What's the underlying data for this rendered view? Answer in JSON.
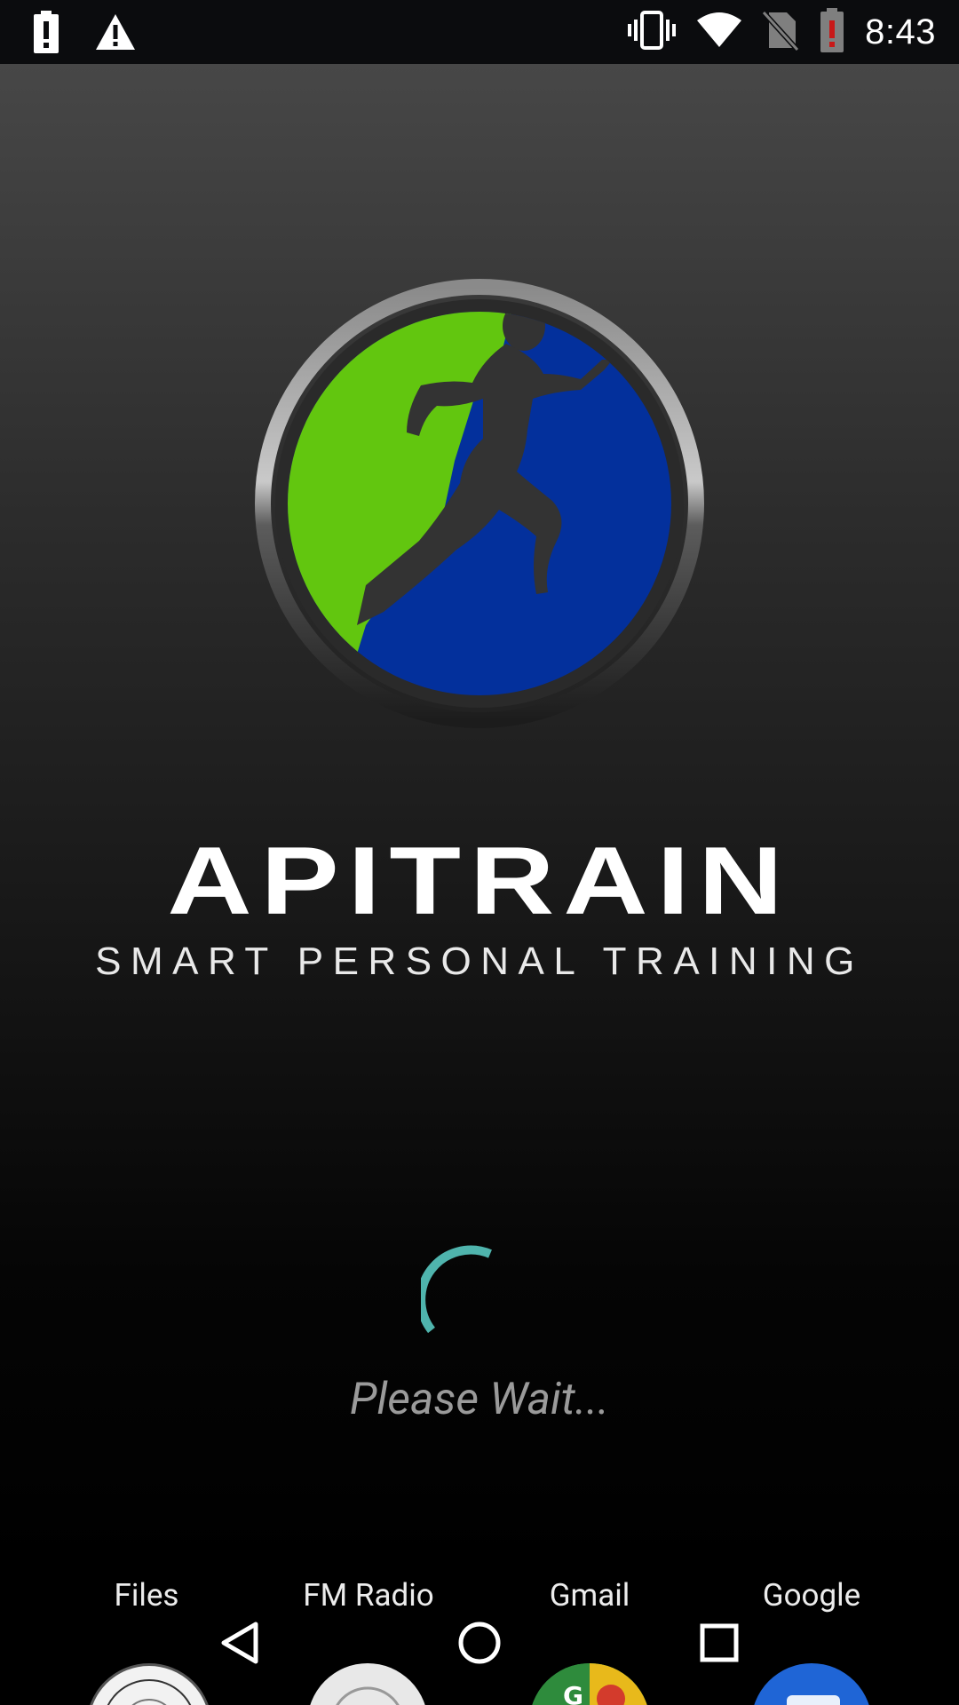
{
  "status_bar": {
    "time": "8:43",
    "left_icons": [
      "battery-alert-icon",
      "warning-icon"
    ],
    "right_icons": [
      "vibrate-icon",
      "wifi-icon",
      "no-sim-icon",
      "battery-low-icon"
    ]
  },
  "splash": {
    "brand_name": "APITRAIN",
    "tagline": "SMART PERSONAL TRAINING",
    "loading_text": "Please Wait...",
    "colors": {
      "logo_green": "#62c60f",
      "logo_blue": "#03309c",
      "spinner": "#4fb4ad"
    }
  },
  "launcher": {
    "apps": [
      {
        "label": "Files",
        "icon": "files-app-icon"
      },
      {
        "label": "FM Radio",
        "icon": "fm-radio-app-icon"
      },
      {
        "label": "Gmail",
        "icon": "gmail-app-icon"
      },
      {
        "label": "Google",
        "icon": "google-app-icon"
      }
    ]
  },
  "nav": {
    "buttons": [
      "back-icon",
      "home-icon",
      "recents-icon"
    ]
  }
}
